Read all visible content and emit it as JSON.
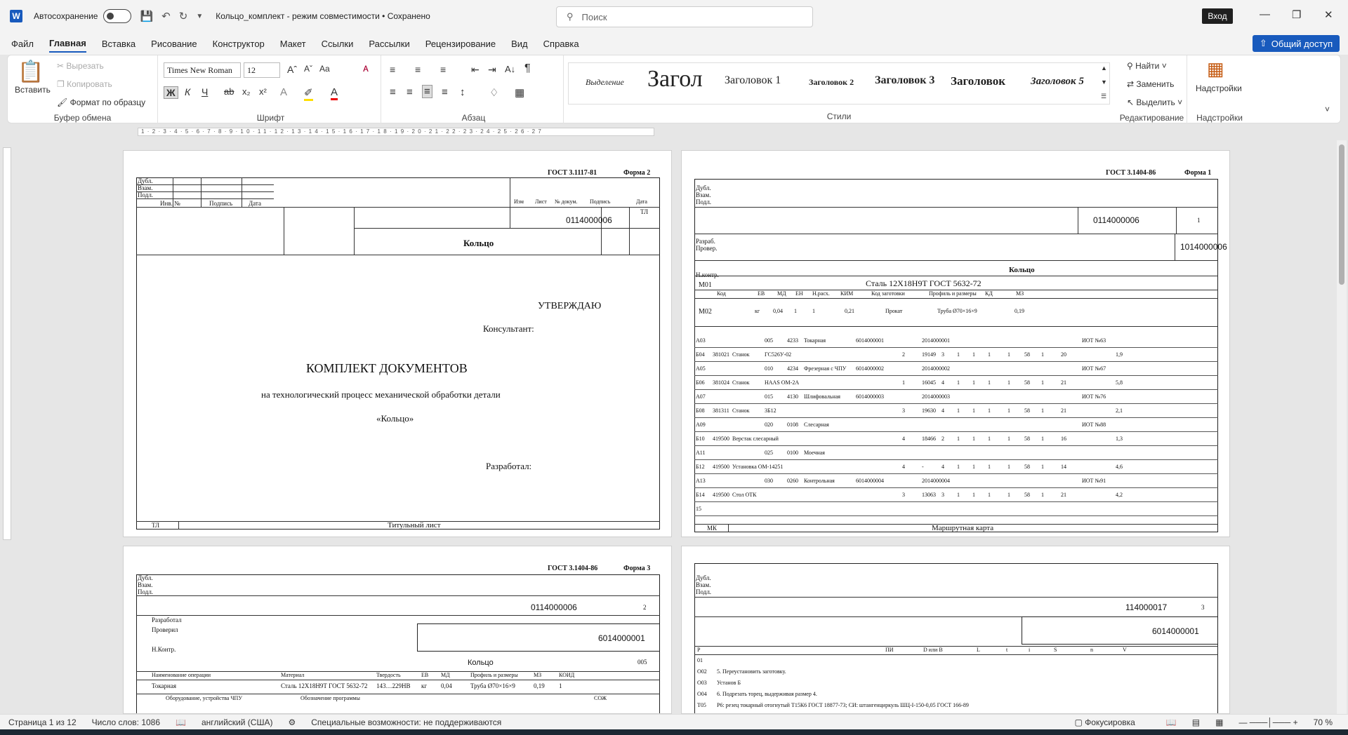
{
  "titlebar": {
    "logo": "W",
    "autosave": "Автосохранение",
    "doc_title": "Кольцо_комплект  -  режим совместимости • Сохранено",
    "search_placeholder": "Поиск",
    "login": "Вход"
  },
  "menu": [
    "Файл",
    "Главная",
    "Вставка",
    "Рисование",
    "Конструктор",
    "Макет",
    "Ссылки",
    "Рассылки",
    "Рецензирование",
    "Вид",
    "Справка"
  ],
  "share": "Общий доступ",
  "ribbon": {
    "clipboard": {
      "paste": "Вставить",
      "cut": "Вырезать",
      "copy": "Копировать",
      "format": "Формат по образцу",
      "label": "Буфер обмена"
    },
    "font": {
      "name": "Times New Roman",
      "size": "12",
      "label": "Шрифт"
    },
    "paragraph": {
      "label": "Абзац"
    },
    "styles": {
      "items": [
        "Выделение",
        "Загол",
        "Заголовок 1",
        "Заголовок 2",
        "Заголовок 3",
        "Заголовок",
        "Заголовок 5"
      ],
      "label": "Стили"
    },
    "editing": {
      "find": "Найти",
      "replace": "Заменить",
      "select": "Выделить",
      "label": "Редактирование"
    },
    "addins": {
      "name": "Надстройки",
      "label": "Надстройки"
    }
  },
  "page1": {
    "gost": "ГОСТ 3.1117-81",
    "forma": "Форма 2",
    "dubl": "Дубл.",
    "vzam": "Взам.",
    "podl": "Подл.",
    "inv": "Инв. №",
    "podpis": "Подпись",
    "data": "Дата",
    "izm": "Изм",
    "list": "Лист",
    "ndoc": "№ докум.",
    "podp2": "Подпись",
    "data2": "Дата",
    "tl": "ТЛ",
    "code": "0114000006",
    "name": "Кольцо",
    "utv": "УТВЕРЖДАЮ",
    "kons": "Консультант:",
    "komplekt": "КОМПЛЕКТ ДОКУМЕНТОВ",
    "tp": "на технологический процесс механической обработки детали",
    "detal": "«Кольцо»",
    "razr": "Разработал:",
    "tl_bottom": "ТЛ",
    "tit": "Титульный лист"
  },
  "page2": {
    "gost": "ГОСТ 3.1404-86",
    "forma": "Форма 1",
    "code": "0114000006",
    "sheet": "1",
    "code2": "1014000006",
    "razrab": "Разраб.",
    "prover": "Провер.",
    "nkontr": "Н.контр.",
    "name": "Кольцо",
    "m01": "М01",
    "material": "Сталь 12Х18Н9Т ГОСТ 5632-72",
    "m02": "М02",
    "hdr": [
      "Код",
      "ЕВ",
      "МД",
      "ЕН",
      "Н.расх.",
      "КИМ",
      "Код заготовки",
      "Профиль и размеры",
      "КД",
      "МЗ"
    ],
    "m02vals": [
      "кг",
      "0,04",
      "1",
      "1",
      "0,21",
      "Прокат",
      "Труба Ø70×16×9",
      "0,19"
    ],
    "rows": [
      [
        "А03",
        "",
        "",
        "005",
        "4233",
        "Токарная",
        "6014000001",
        "",
        "2014000001",
        "",
        "",
        "",
        "",
        "",
        "",
        "",
        "",
        "ИОТ №63",
        ""
      ],
      [
        "Б04",
        "381021",
        "Станок",
        "ГС526У-02",
        "",
        "",
        "",
        "2",
        "19149",
        "3",
        "1",
        "1",
        "1",
        "1",
        "58",
        "1",
        "20",
        "",
        "1,9"
      ],
      [
        "А05",
        "",
        "",
        "010",
        "4234",
        "Фрезерная с ЧПУ",
        "6014000002",
        "",
        "2014000002",
        "",
        "",
        "",
        "",
        "",
        "",
        "",
        "",
        "ИОТ №67",
        ""
      ],
      [
        "Б06",
        "381024",
        "Станок",
        "HAAS OM-2A",
        "",
        "",
        "",
        "1",
        "16045",
        "4",
        "1",
        "1",
        "1",
        "1",
        "58",
        "1",
        "21",
        "",
        "5,8"
      ],
      [
        "А07",
        "",
        "",
        "015",
        "4130",
        "Шлифовальная",
        "6014000003",
        "",
        "2014000003",
        "",
        "",
        "",
        "",
        "",
        "",
        "",
        "",
        "ИОТ №76",
        ""
      ],
      [
        "Б08",
        "381311",
        "Станок",
        "3Б12",
        "",
        "",
        "",
        "3",
        "19630",
        "4",
        "1",
        "1",
        "1",
        "1",
        "58",
        "1",
        "21",
        "",
        "2,1"
      ],
      [
        "А09",
        "",
        "",
        "020",
        "0108",
        "Слесарная",
        "",
        "",
        "",
        "",
        "",
        "",
        "",
        "",
        "",
        "",
        "",
        "ИОТ №88",
        ""
      ],
      [
        "Б10",
        "419500",
        "Верстак слесарный",
        "",
        "",
        "",
        "",
        "4",
        "18466",
        "2",
        "1",
        "1",
        "1",
        "1",
        "58",
        "1",
        "16",
        "",
        "1,3"
      ],
      [
        "А11",
        "",
        "",
        "025",
        "0100",
        "Моечная",
        "",
        "",
        "",
        "",
        "",
        "",
        "",
        "",
        "",
        "",
        "",
        "",
        ""
      ],
      [
        "Б12",
        "419500",
        "Установка ОМ-14251",
        "",
        "",
        "",
        "",
        "4",
        "-",
        "4",
        "1",
        "1",
        "1",
        "1",
        "58",
        "1",
        "14",
        "",
        "4,6"
      ],
      [
        "А13",
        "",
        "",
        "030",
        "0260",
        "Контрольная",
        "6014000004",
        "",
        "2014000004",
        "",
        "",
        "",
        "",
        "",
        "",
        "",
        "",
        "ИОТ №91",
        ""
      ],
      [
        "Б14",
        "419500",
        "Стол ОТК",
        "",
        "",
        "",
        "",
        "3",
        "13063",
        "3",
        "1",
        "1",
        "1",
        "1",
        "58",
        "1",
        "21",
        "",
        "4,2"
      ],
      [
        "15",
        "",
        "",
        "",
        "",
        "",
        "",
        "",
        "",
        "",
        "",
        "",
        "",
        "",
        "",
        "",
        "",
        "",
        ""
      ]
    ],
    "mk": "МК",
    "mk_name": "Маршрутная карта"
  },
  "page3": {
    "gost": "ГОСТ 3.1404-86",
    "forma": "Форма 3",
    "code": "0114000006",
    "sheet": "2",
    "code2": "6014000001",
    "razrab": "Разработал",
    "prover": "Проверил",
    "nkontr": "Н.Контр.",
    "name": "Кольцо",
    "op_no": "005",
    "hdr": [
      "Наименование операции",
      "Материал",
      "Твердость",
      "ЕВ",
      "МД",
      "Профиль и размеры",
      "МЗ",
      "КОИД"
    ],
    "vals": [
      "Токарная",
      "Сталь 12Х18Н9Т ГОСТ 5632-72",
      "143…229HB",
      "кг",
      "0,04",
      "Труба Ø70×16×9",
      "0,19",
      "1"
    ],
    "eq": "Оборудование, устройства ЧПУ",
    "prog": "Обозначение программы",
    "sozh": "СОЖ"
  },
  "page4": {
    "code": "114000017",
    "sheet": "3",
    "code2": "6014000001",
    "hdr": [
      "Р",
      "ПИ",
      "D или В",
      "L",
      "t",
      "i",
      "S",
      "n",
      "V"
    ],
    "rows": [
      [
        "01",
        ""
      ],
      [
        "О02",
        "5. Переустановить заготовку."
      ],
      [
        "О03",
        "Установ Б"
      ],
      [
        "О04",
        "6. Подрезать торец, выдерживая размер 4."
      ],
      [
        "Т05",
        "Р6: резец токарный отогнутый Т15К6 ГОСТ 18877-73;  СИ: штангенциркуль ШЦ-I-150-0,05 ГОСТ 166-89"
      ]
    ]
  },
  "status": {
    "page": "Страница 1 из 12",
    "words": "Число слов: 1086",
    "lang": "английский (США)",
    "access": "Специальные возможности: не поддерживаются",
    "focus": "Фокусировка",
    "zoom": "70 %"
  }
}
